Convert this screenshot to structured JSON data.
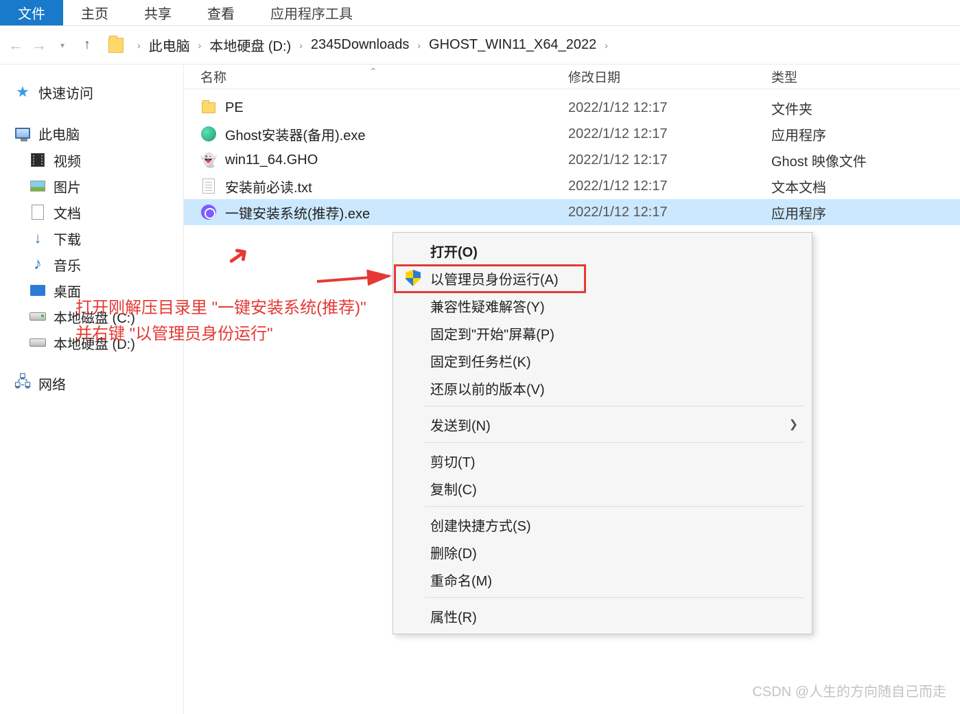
{
  "ribbon": {
    "file": "文件",
    "home": "主页",
    "share": "共享",
    "view": "查看",
    "tools": "应用程序工具"
  },
  "breadcrumb": {
    "segments": [
      "此电脑",
      "本地硬盘 (D:)",
      "2345Downloads",
      "GHOST_WIN11_X64_2022"
    ]
  },
  "sidebar": {
    "quick_access": "快速访问",
    "this_pc": "此电脑",
    "videos": "视频",
    "pictures": "图片",
    "documents": "文档",
    "downloads": "下载",
    "music": "音乐",
    "desktop": "桌面",
    "drive_c": "本地磁盘 (C:)",
    "drive_d": "本地硬盘 (D:)",
    "network": "网络"
  },
  "columns": {
    "name": "名称",
    "date": "修改日期",
    "type": "类型"
  },
  "files": [
    {
      "name": "PE",
      "date": "2022/1/12 12:17",
      "type": "文件夹",
      "icon": "folder"
    },
    {
      "name": "Ghost安装器(备用).exe",
      "date": "2022/1/12 12:17",
      "type": "应用程序",
      "icon": "exe-green"
    },
    {
      "name": "win11_64.GHO",
      "date": "2022/1/12 12:17",
      "type": "Ghost 映像文件",
      "icon": "gho"
    },
    {
      "name": "安装前必读.txt",
      "date": "2022/1/12 12:17",
      "type": "文本文档",
      "icon": "txt"
    },
    {
      "name": "一键安装系统(推荐).exe",
      "date": "2022/1/12 12:17",
      "type": "应用程序",
      "icon": "exe-purple",
      "selected": true
    }
  ],
  "context_menu": {
    "open": "打开(O)",
    "run_as_admin": "以管理员身份运行(A)",
    "compat": "兼容性疑难解答(Y)",
    "pin_start": "固定到\"开始\"屏幕(P)",
    "pin_taskbar": "固定到任务栏(K)",
    "restore": "还原以前的版本(V)",
    "send_to": "发送到(N)",
    "cut": "剪切(T)",
    "copy": "复制(C)",
    "shortcut": "创建快捷方式(S)",
    "delete": "删除(D)",
    "rename": "重命名(M)",
    "properties": "属性(R)"
  },
  "annotation": {
    "line1": "打开刚解压目录里 \"一键安装系统(推荐)\"",
    "line2": "并右键 \"以管理员身份运行\""
  },
  "watermark": "CSDN @人生的方向随自己而走"
}
